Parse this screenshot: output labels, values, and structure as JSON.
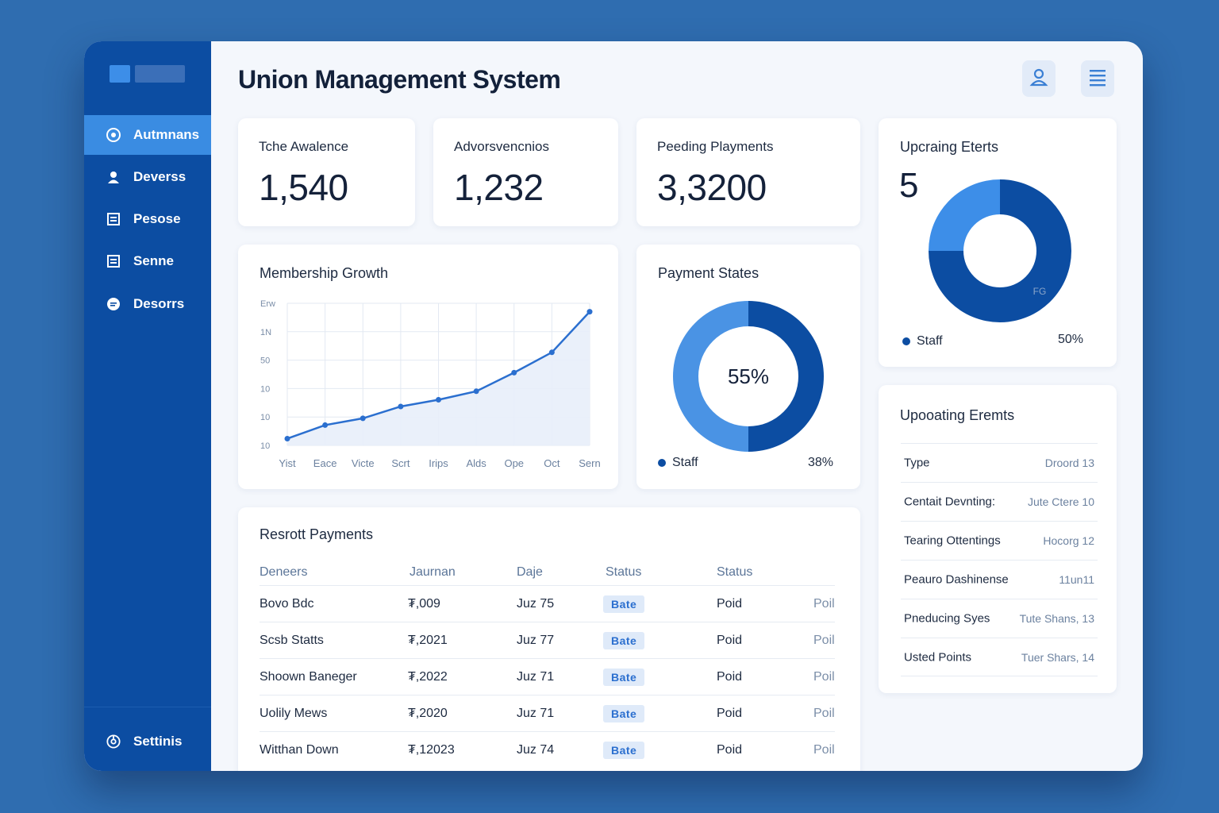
{
  "app": {
    "title": "Union Management System"
  },
  "sidebar": {
    "items": [
      {
        "label": "Autmnans",
        "icon": "dashboard-icon",
        "active": true
      },
      {
        "label": "Deverss",
        "icon": "user-icon",
        "active": false
      },
      {
        "label": "Pesose",
        "icon": "document-icon",
        "active": false
      },
      {
        "label": "Senne",
        "icon": "document-icon",
        "active": false
      },
      {
        "label": "Desorrs",
        "icon": "chat-icon",
        "active": false
      }
    ],
    "settings_label": "Settinis"
  },
  "header": {
    "profile_icon": "user-icon",
    "menu_icon": "menu-icon"
  },
  "stats": [
    {
      "label": "Tche Awalence",
      "value": "1,540"
    },
    {
      "label": "Advorsvencnios",
      "value": "1,232"
    },
    {
      "label": "Peeding Playments",
      "value": "3,3200"
    }
  ],
  "upcoming_top": {
    "title": "Upcraing Eterts",
    "value": "5",
    "chart_data": {
      "type": "pie",
      "donut": true,
      "slices": [
        {
          "label": "",
          "value": 50,
          "color": "#0c4da2"
        },
        {
          "label": "",
          "value": 25,
          "color": "#0c4da2"
        },
        {
          "label": "",
          "value": 25,
          "color": "#3d8ee8"
        }
      ],
      "inner_label": "FG"
    },
    "legend_label": "Staff",
    "legend_value": "50%"
  },
  "membership": {
    "title": "Membership Growth",
    "chart_data": {
      "type": "area",
      "categories": [
        "Yist",
        "Eace",
        "Victe",
        "Scrt",
        "Irips",
        "Alds",
        "Ope",
        "Oct",
        "Sern"
      ],
      "y_tick_labels": [
        "Erw",
        "1N",
        "50",
        "10",
        "10",
        "10"
      ],
      "values": [
        12,
        20,
        24,
        31,
        35,
        40,
        51,
        63,
        87
      ],
      "ylim": [
        8,
        92
      ],
      "color": "#2b6fcf",
      "grid": true
    }
  },
  "payment_states": {
    "title": "Payment States",
    "chart_data": {
      "type": "pie",
      "donut": true,
      "slices": [
        {
          "label": "",
          "value": 50,
          "color": "#0c4da2"
        },
        {
          "label": "",
          "value": 50,
          "color": "#4a93e4"
        }
      ],
      "center_label": "55%"
    },
    "legend_label": "Staff",
    "legend_value": "38%"
  },
  "recent_payments": {
    "title": "Resrott Payments",
    "columns": [
      "Deneers",
      "Jaurnan",
      "Daje",
      "Status",
      "Status"
    ],
    "rows": [
      {
        "name": "Bovo Bdc",
        "amount": "₮,009",
        "date": "Juz 75",
        "badge": "Bate",
        "status": "Poid",
        "extra": "Poil"
      },
      {
        "name": "Scsb Statts",
        "amount": "₮,2021",
        "date": "Juz 77",
        "badge": "Bate",
        "status": "Poid",
        "extra": "Poil"
      },
      {
        "name": "Shoown Baneger",
        "amount": "₮,2022",
        "date": "Juz 71",
        "badge": "Bate",
        "status": "Poid",
        "extra": "Poil"
      },
      {
        "name": "Uolily Mews",
        "amount": "₮,2020",
        "date": "Juz 71",
        "badge": "Bate",
        "status": "Poid",
        "extra": "Poil"
      },
      {
        "name": "Witthan Down",
        "amount": "₮,12023",
        "date": "Juz 74",
        "badge": "Bate",
        "status": "Poid",
        "extra": "Poil"
      }
    ]
  },
  "upcoming_events": {
    "title": "Upooating Eremts",
    "rows": [
      {
        "label": "Type",
        "value": "Droord 13"
      },
      {
        "label": "Centait Devnting:",
        "value": "Jute Ctere 10"
      },
      {
        "label": "Tearing Ottentings",
        "value": "Hocorg 12"
      },
      {
        "label": "Peauro Dashinense",
        "value": "11un11"
      },
      {
        "label": "Pneducing Syes",
        "value": "Tute Shans, 13"
      },
      {
        "label": "Usted Points",
        "value": "Tuer Shars, 14"
      }
    ]
  }
}
